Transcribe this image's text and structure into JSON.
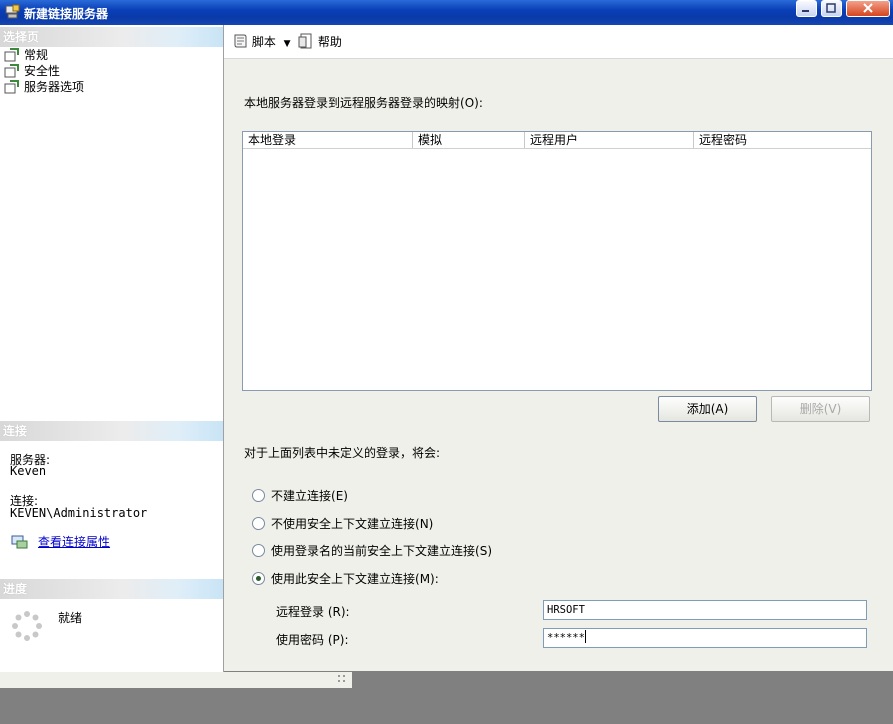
{
  "window": {
    "title": "新建链接服务器"
  },
  "left": {
    "select_page_header": "选择页",
    "pages": [
      {
        "label": "常规",
        "icon": "page-icon"
      },
      {
        "label": "安全性",
        "icon": "page-icon"
      },
      {
        "label": "服务器选项",
        "icon": "page-icon"
      }
    ],
    "connection_header": "连接",
    "server_label": "服务器:",
    "server_value": "Keven",
    "connection_label": "连接:",
    "connection_value": "KEVEN\\Administrator",
    "view_props_link": "查看连接属性",
    "progress_header": "进度",
    "progress_status": "就绪"
  },
  "toolbar": {
    "script_label": "脚本",
    "help_label": "帮助"
  },
  "main": {
    "mapping_label": "本地服务器登录到远程服务器登录的映射",
    "mapping_hotkey": "(O):",
    "columns": [
      "本地登录",
      "模拟",
      "远程用户",
      "远程密码"
    ],
    "add_button": "添加",
    "add_hotkey": "(A)",
    "remove_button": "删除",
    "remove_hotkey": "(V)",
    "undefined_label": "对于上面列表中未定义的登录，将会:",
    "options": [
      {
        "label": "不建立连接",
        "hotkey": "(E)",
        "checked": false
      },
      {
        "label": "不使用安全上下文建立连接",
        "hotkey": "(N)",
        "checked": false
      },
      {
        "label": "使用登录名的当前安全上下文建立连接",
        "hotkey": "(S)",
        "checked": false
      },
      {
        "label": "使用此安全上下文建立连接",
        "hotkey": "(M):",
        "checked": true
      }
    ],
    "remote_login_label": "远程登录",
    "remote_login_hotkey": "(R):",
    "remote_login_value": "HRSOFT",
    "password_label": "使用密码",
    "password_hotkey": "(P):",
    "password_value": "******"
  },
  "colors": {
    "titlebar": "#0a3fb8",
    "panel_bg": "#f0f0ea",
    "link": "#0000cc"
  }
}
